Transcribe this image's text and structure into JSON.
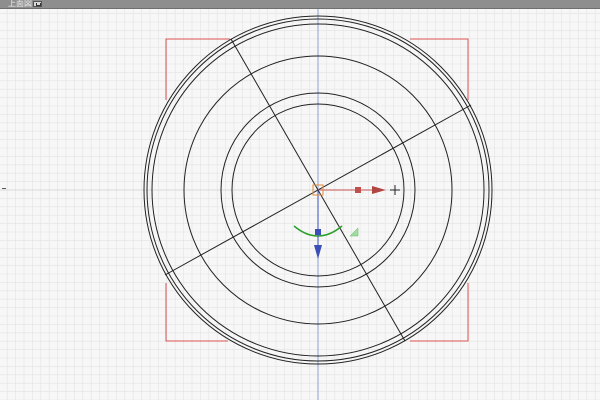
{
  "viewport": {
    "label": "上面図",
    "background": "#f7f7f7",
    "grid_minor_color": "#e3e3e3",
    "grid_major_color": "#d2d2d2",
    "axis_y_color": "#8fa2d6",
    "bounds_color": "#d9534f",
    "mesh_color": "#222222"
  },
  "gizmo": {
    "x_axis_color": "#c0504d",
    "z_axis_color": "#3b4fb8",
    "rotate_color": "#2ca02c",
    "pivot_color": "#e08a3a"
  },
  "icons": {
    "move_cursor": "crosshair-plus-icon",
    "view_menu": "view-menu-icon"
  }
}
